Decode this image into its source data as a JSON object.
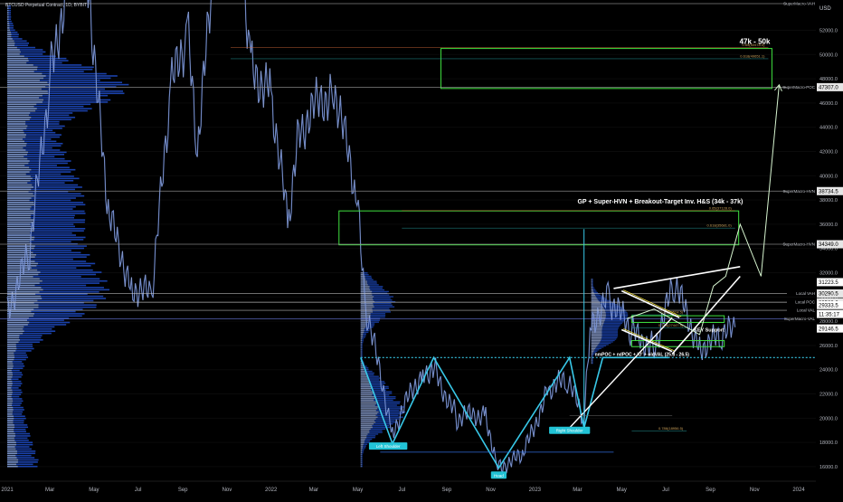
{
  "header": {
    "symbol_label": "BTCUSD Perpetual Contract, 1D, BYBIT",
    "currency": "USD"
  },
  "chart_data": {
    "type": "line",
    "title": "",
    "xlabel": "",
    "ylabel": "",
    "ylim": [
      14800,
      54500
    ],
    "y_ticks": [
      16000,
      18000,
      20000,
      22000,
      24000,
      26000,
      28000,
      30000,
      32000,
      34000,
      36000,
      38000,
      40000,
      42000,
      44000,
      46000,
      48000,
      50000,
      52000
    ],
    "x_ticks": [
      "2021",
      "Mar",
      "May",
      "Jul",
      "Sep",
      "Nov",
      "2022",
      "Mar",
      "May",
      "Jul",
      "Sep",
      "Nov",
      "2023",
      "Mar",
      "May",
      "Jul",
      "Sep",
      "Nov",
      "2024"
    ],
    "price_path": {
      "x": [
        "2021-01-01",
        "2021-02-01",
        "2021-03-01",
        "2021-04-14",
        "2021-05-19",
        "2021-06-22",
        "2021-07-20",
        "2021-08-15",
        "2021-09-07",
        "2021-09-21",
        "2021-10-20",
        "2021-11-10",
        "2021-12-04",
        "2022-01-01",
        "2022-01-24",
        "2022-02-10",
        "2022-03-29",
        "2022-04-30",
        "2022-05-12",
        "2022-06-18",
        "2022-07-30",
        "2022-08-15",
        "2022-09-15",
        "2022-10-25",
        "2022-11-09",
        "2022-12-15",
        "2023-01-20",
        "2023-02-15",
        "2023-03-10",
        "2023-03-20",
        "2023-04-14",
        "2023-05-15",
        "2023-06-15",
        "2023-07-13",
        "2023-08-17",
        "2023-09-15",
        "2023-10-05"
      ],
      "y": [
        29000,
        33500,
        48000,
        63000,
        37000,
        31000,
        30000,
        47000,
        52000,
        42000,
        61000,
        68000,
        49000,
        47000,
        36000,
        44000,
        47500,
        38000,
        29000,
        19000,
        24000,
        24000,
        20000,
        20500,
        16000,
        16800,
        22500,
        23000,
        20000,
        28000,
        30000,
        27000,
        26000,
        31000,
        26000,
        26500,
        27500
      ]
    },
    "levels": [
      {
        "label": "SuperMacro-VAH",
        "y": 54200,
        "color": "#9a9a9a"
      },
      {
        "label": "SuperMacro-POC",
        "y": 47307,
        "color": "#9a9a9a",
        "value": "47307.0"
      },
      {
        "label": "SuperMacro-HVN",
        "y": 38734.5,
        "color": "#9a9a9a",
        "value": "38734.5"
      },
      {
        "label": "SuperMacro-HVN",
        "y": 34349,
        "color": "#9a9a9a",
        "value": "34349.0"
      },
      {
        "label": "Local VAH",
        "y": 30290.5,
        "color": "#cfcfcf",
        "value": "30290.5"
      },
      {
        "label": "Local POC",
        "y": 29569,
        "color": "#cfcfcf",
        "value": "29569.0"
      },
      {
        "label": "Local VAL",
        "y": 28900,
        "color": "#cfcfcf"
      },
      {
        "label": "SuperMacro-VAL",
        "y": 28200,
        "color": "#7b8cff"
      }
    ],
    "price_labels": [
      {
        "value": "31223.5",
        "y": 31223.5,
        "bg": "#ffffff",
        "fg": "#000000"
      },
      {
        "value": "29333.5",
        "y": 29333.5,
        "bg": "#ffffff",
        "fg": "#000000"
      },
      {
        "value": "11:35:17",
        "y": 28600,
        "bg": "#ffffff",
        "fg": "#000000"
      },
      {
        "value": "29146.5",
        "y": 27400,
        "bg": "#ffffff",
        "fg": "#000000"
      }
    ],
    "zones": [
      {
        "label": "47k - 50k",
        "x0": "2022-08-24",
        "x1": "2023-11-25",
        "y0": 47200,
        "y1": 50500,
        "color": "#3fe03f"
      },
      {
        "label": "GP + Super-HVN + Breakout-Target Inv. H&S (34k - 37k)",
        "x0": "2022-04-05",
        "x1": "2023-10-10",
        "y0": 34300,
        "y1": 37100,
        "color": "#3fe03f"
      },
      {
        "label": "KEY Support",
        "x0": "2023-05-15",
        "x1": "2023-09-20",
        "y0": 27900,
        "y1": 28450,
        "color": "#3fe03f"
      },
      {
        "label": "",
        "x0": "2023-05-15",
        "x1": "2023-09-20",
        "y0": 25900,
        "y1": 26400,
        "color": "#3fe03f"
      }
    ],
    "fib_labels": [
      {
        "value": "0.65(50578.0)",
        "y": 50578
      },
      {
        "value": "0.618(49651.1)",
        "y": 49651.1
      },
      {
        "value": "0.65(37128.0)",
        "y": 37128
      },
      {
        "value": "0.618(35681.0)",
        "y": 35681
      },
      {
        "value": "0.65(28524.5)",
        "y": 28524.5
      },
      {
        "value": "0.786(27447.5)",
        "y": 27447.5
      },
      {
        "value": "0.786(18956.5)",
        "y": 18956.5
      }
    ],
    "annotations": [
      {
        "text": "nmPOC + ndPOC + 'O' + oldVAL (25.8 - 26.5)",
        "y": 25000
      },
      {
        "text": "Head",
        "y": 15300
      },
      {
        "text": "Right Shoulder",
        "y": 19000
      },
      {
        "text": "Left Shoulder",
        "y": 17700
      }
    ],
    "hs_pattern": {
      "x": [
        "2022-05-05",
        "2022-06-18",
        "2022-08-14",
        "2022-11-12",
        "2023-02-18",
        "2023-03-10",
        "2023-04-05",
        "2023-07-05"
      ],
      "y": [
        25000,
        17900,
        25000,
        15900,
        25000,
        19200,
        25000,
        25000
      ]
    },
    "projection": {
      "x": [
        "2023-05-08",
        "2023-06-15",
        "2023-08-17",
        "2023-09-05",
        "2023-09-22",
        "2023-10-12",
        "2023-11-10",
        "2023-12-05"
      ],
      "y": [
        28200,
        29000,
        26900,
        30900,
        31700,
        36000,
        31700,
        47500
      ]
    }
  }
}
